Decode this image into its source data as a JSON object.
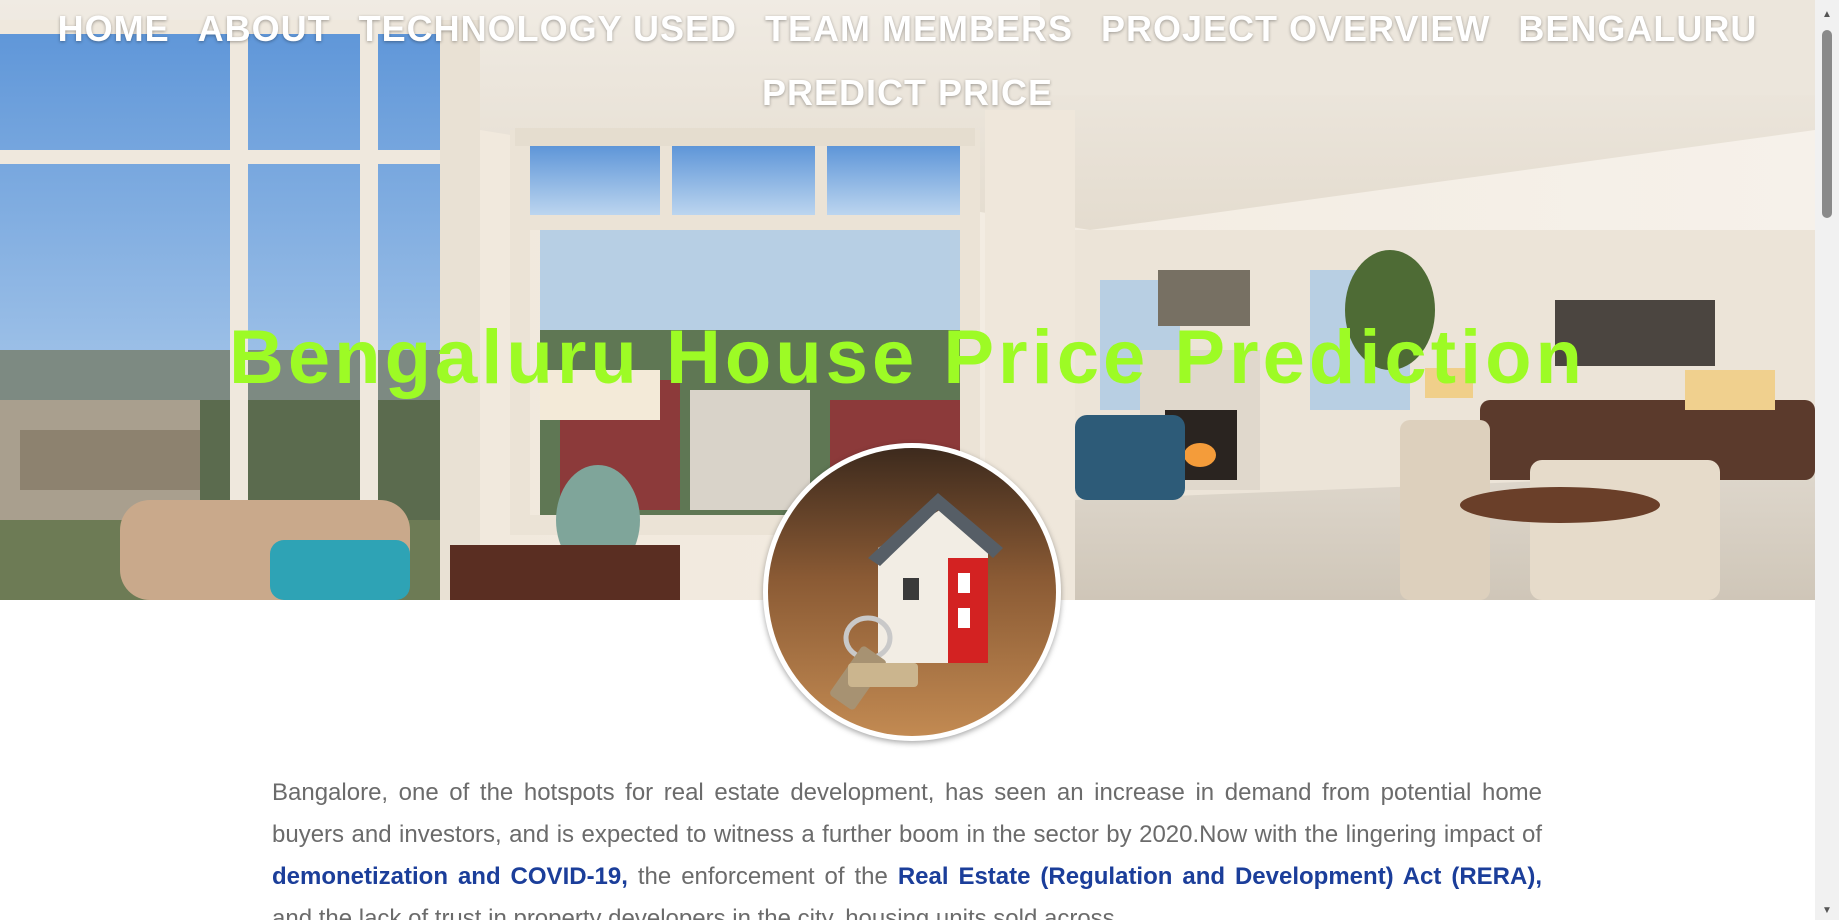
{
  "nav": {
    "row1": [
      {
        "label": "HOME"
      },
      {
        "label": "ABOUT"
      },
      {
        "label": "TECHNOLOGY USED"
      },
      {
        "label": "TEAM MEMBERS"
      },
      {
        "label": "PROJECT OVERVIEW"
      },
      {
        "label": "BENGALURU"
      }
    ],
    "row2": [
      {
        "label": "PREDICT PRICE"
      }
    ]
  },
  "hero": {
    "title": "Bengaluru House Price Prediction"
  },
  "article": {
    "p1": "Bangalore, one of the hotspots for real estate development, has seen an increase in demand from potential home buyers and investors, and is expected to witness a further boom in the sector by 2020.Now with the lingering impact of ",
    "hl1": "demonetization and COVID-19,",
    "p2": " the enforcement of the ",
    "hl2": "Real Estate (Regulation and Development) Act (RERA),",
    "p3": " and the lack of trust in property developers in the city, housing units sold across"
  },
  "colors": {
    "title": "#9dfb25",
    "nav": "#ffffff",
    "link": "#1b3e9a",
    "body_text": "#6b6b6b"
  },
  "icons": {
    "round_image": "house-keychain-photo",
    "hero_background": "living-room-photo"
  }
}
